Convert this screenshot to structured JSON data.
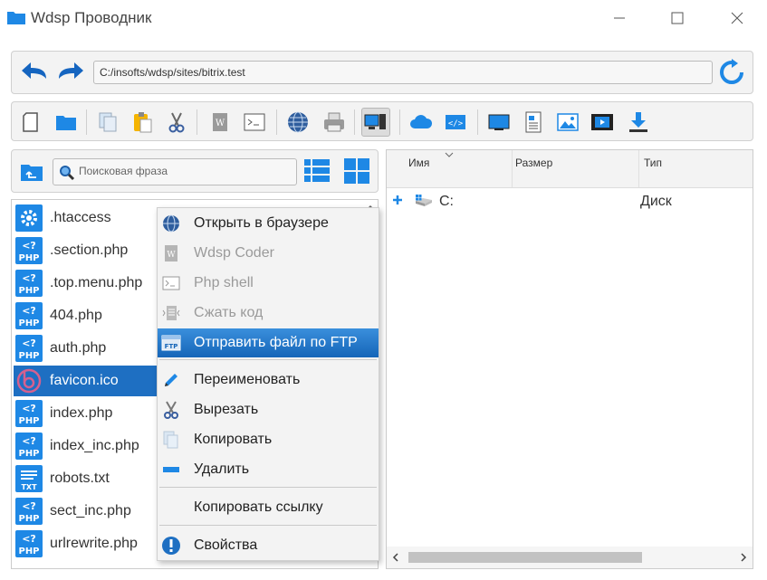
{
  "window": {
    "title": "Wdsp Проводник",
    "minimize_icon": "minimize-icon",
    "maximize_icon": "maximize-icon",
    "close_icon": "close-icon"
  },
  "address": {
    "path": "C:/insofts/wdsp/sites/bitrix.test"
  },
  "toolbar": {
    "buttons": [
      "new-file-icon",
      "new-folder-icon",
      "copy-icon",
      "paste-icon",
      "cut-icon",
      "wdsp-coder-icon",
      "terminal-icon",
      "browser-icon",
      "printer-icon",
      "computer-icon",
      "cloud-icon",
      "code-icon",
      "monitor-icon",
      "document-icon",
      "image-icon",
      "video-icon",
      "download-icon"
    ]
  },
  "left": {
    "search_placeholder": "Поисковая фраза",
    "files": [
      {
        "name": ".htaccess",
        "icon": "gear-icon"
      },
      {
        "name": ".section.php",
        "icon": "php-icon"
      },
      {
        "name": ".top.menu.php",
        "icon": "php-icon"
      },
      {
        "name": "404.php",
        "icon": "php-icon"
      },
      {
        "name": "auth.php",
        "icon": "php-icon"
      },
      {
        "name": "favicon.ico",
        "icon": "favicon-icon",
        "selected": true
      },
      {
        "name": "index.php",
        "icon": "php-icon"
      },
      {
        "name": "index_inc.php",
        "icon": "php-icon"
      },
      {
        "name": "robots.txt",
        "icon": "txt-icon"
      },
      {
        "name": "sect_inc.php",
        "icon": "php-icon"
      },
      {
        "name": "urlrewrite.php",
        "icon": "php-icon"
      }
    ]
  },
  "right": {
    "columns": [
      "Имя",
      "Размер",
      "Тип"
    ],
    "rows": [
      {
        "name": "C:",
        "type": "Диск"
      }
    ]
  },
  "context_menu": {
    "items": [
      {
        "label": "Открыть в браузере",
        "icon": "globe-icon"
      },
      {
        "label": "Wdsp Coder",
        "icon": "wdsp-coder-icon",
        "disabled": true
      },
      {
        "label": "Php shell",
        "icon": "terminal-icon",
        "disabled": true
      },
      {
        "label": "Сжать код",
        "icon": "compress-icon",
        "disabled": true
      },
      {
        "label": "Отправить файл по FTP",
        "icon": "ftp-icon",
        "highlight": true
      },
      {
        "label": "Переименовать",
        "icon": "pencil-icon"
      },
      {
        "label": "Вырезать",
        "icon": "scissors-icon"
      },
      {
        "label": "Копировать",
        "icon": "copy-icon"
      },
      {
        "label": "Удалить",
        "icon": "minus-icon"
      },
      {
        "label": "Копировать ссылку",
        "icon": ""
      },
      {
        "label": "Свойства",
        "icon": "info-icon"
      }
    ]
  },
  "colors": {
    "accent": "#1e6fc2",
    "icon_blue": "#1e88e5",
    "menu_highlight": "#1565b8"
  }
}
